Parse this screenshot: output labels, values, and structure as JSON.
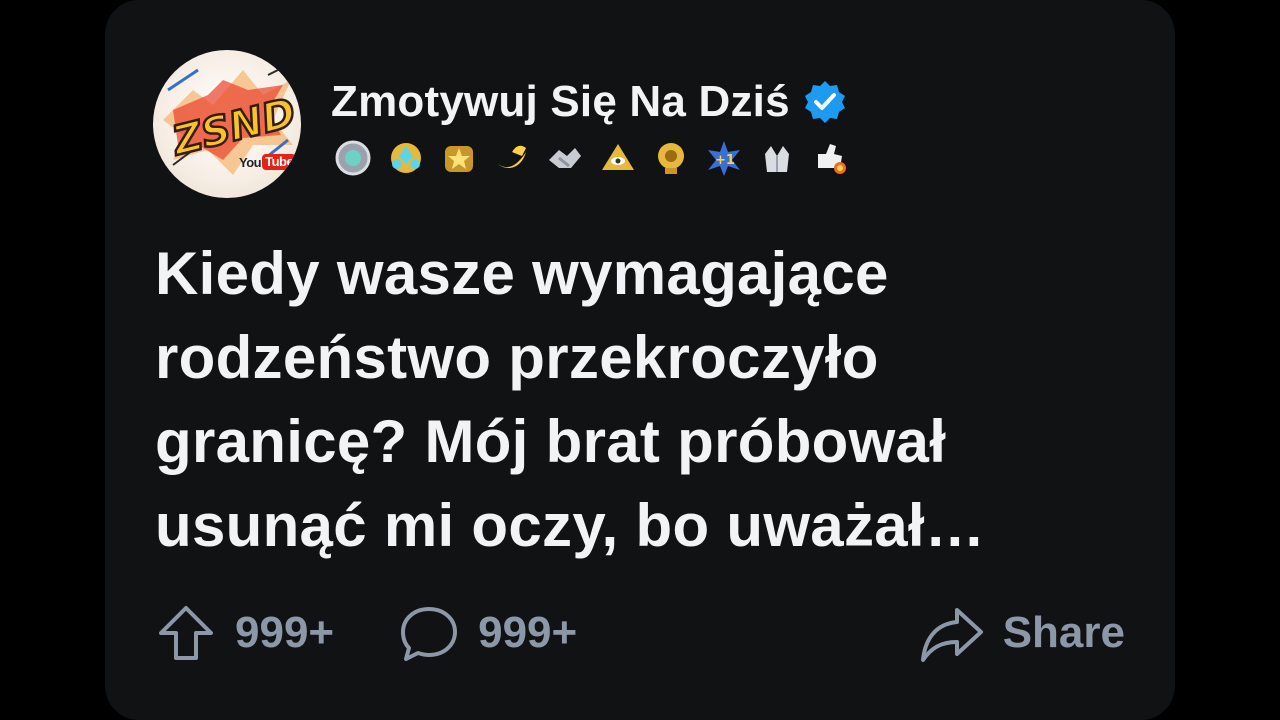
{
  "channel": {
    "name": "Zmotywuj Się Na Dziś",
    "verified": true,
    "avatar_text": "ZSND",
    "avatar_badge": {
      "brand_prefix": "You",
      "brand_suffix": "Tube"
    }
  },
  "badges": [
    "silver-award-icon",
    "gem-cluster-icon",
    "gold-star-icon",
    "banana-icon",
    "handshake-icon",
    "illuminati-eye-icon",
    "gold-trophy-icon",
    "plus-one-icon",
    "clapping-hands-icon",
    "rocket-thumb-icon"
  ],
  "post": {
    "text": "Kiedy wasze wymagające rodzeństwo przekroczyło granicę? Mój brat próbował usunąć mi oczy, bo uważał…"
  },
  "actions": {
    "upvote_count": "999+",
    "comment_count": "999+",
    "share_label": "Share"
  },
  "colors": {
    "card_background": "#111214",
    "page_background": "#000000",
    "text": "#f1f3f5",
    "muted": "#8c98a8",
    "verified_blue": "#1d9bf0"
  }
}
